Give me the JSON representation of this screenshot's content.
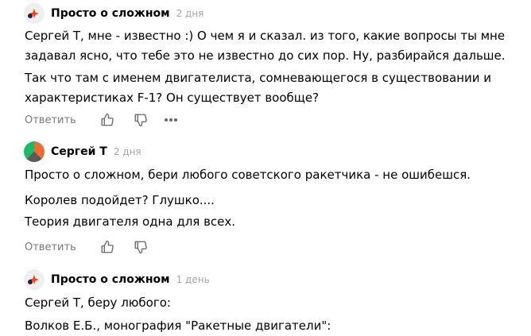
{
  "comments": [
    {
      "author": "Просто о сложном",
      "time": "2 дня",
      "avatar_icon": "brand-star-logo",
      "paragraphs": [
        "Сергей Т, мне - известно :) О чем я и сказал. из того, какие вопросы ты мне задавал ясно, что тебе это не известно до сих пор. Ну, разбирайся дальше.",
        "Так что там с именем двигателиста, сомневающегося в существовании и характеристиках F-1? Он существует вообще?"
      ],
      "reply_label": "Ответить"
    },
    {
      "author": "Сергей Т",
      "time": "2 дня",
      "avatar_colors": [
        "#f26a32",
        "#5a5a5a",
        "#1fb86a"
      ],
      "paragraphs": [
        "Просто о сложном, бери любого советского ракетчика - не ошибешся.",
        "Королев подойдет? Глушко....",
        "Теория двигателя одна для всех."
      ],
      "reply_label": "Ответить"
    },
    {
      "author": "Просто о сложном",
      "time": "1 день",
      "avatar_icon": "brand-star-logo",
      "paragraphs": [
        "Сергей Т, беру любого:",
        "Волков Е.Б., монография \"Ракетные двигатели\":"
      ]
    }
  ],
  "icons": {
    "like": "thumbs-up-icon",
    "dislike": "thumbs-down-icon",
    "more": "more-dots-icon"
  },
  "colors": {
    "brand_accent": "#ff3d00",
    "muted_text": "#7a7a7a",
    "time_text": "#a5a5a5"
  }
}
